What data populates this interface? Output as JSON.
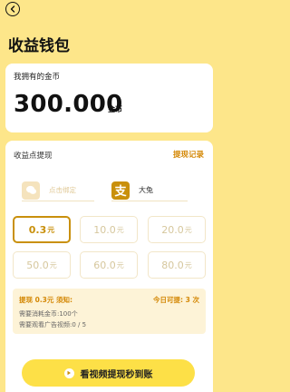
{
  "header": {
    "title": "收益钱包"
  },
  "coins": {
    "label": "我拥有的金币",
    "amount": "300.000",
    "unit": "金币"
  },
  "withdraw": {
    "section_title": "收益点提现",
    "record_link": "提现记录",
    "wechat": {
      "label": "点击绑定",
      "icon": "wechat-icon"
    },
    "alipay": {
      "label": "大兔",
      "icon": "alipay-icon",
      "glyph": "支"
    },
    "amounts": [
      {
        "value": "0.3",
        "unit": "元",
        "selected": true
      },
      {
        "value": "10.0",
        "unit": "元",
        "selected": false
      },
      {
        "value": "20.0",
        "unit": "元",
        "selected": false
      },
      {
        "value": "50.0",
        "unit": "元",
        "selected": false
      },
      {
        "value": "60.0",
        "unit": "元",
        "selected": false
      },
      {
        "value": "80.0",
        "unit": "元",
        "selected": false
      }
    ],
    "info": {
      "title": "提现 0.3元 须知:",
      "quota": "今日可提: 3 次",
      "line1": "需要消耗金币:100个",
      "line2": "需要观看广告视频:0 / 5"
    }
  },
  "cta": {
    "label": "看视频提现秒到账",
    "icon": "play-icon"
  },
  "colors": {
    "background": "#fde68a",
    "accent": "#c9900c",
    "button": "#fde047"
  }
}
